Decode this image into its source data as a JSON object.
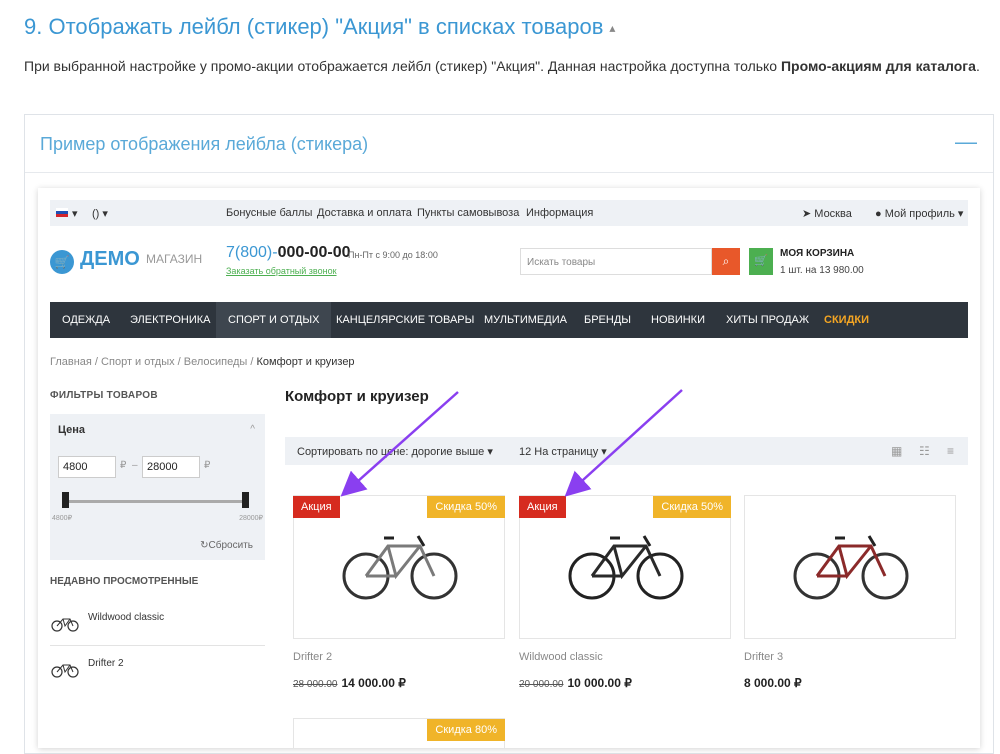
{
  "doc": {
    "title": "9. Отображать лейбл (стикер) \"Акция\" в списках товаров",
    "desc_plain": "При выбранной настройке у промо-акции отображается лейбл (стикер) \"Акция\". Данная настройка доступна только ",
    "desc_bold": "Промо-акциям для каталога",
    "desc_end": ".",
    "spoiler_title": "Пример отображения лейбла (стикера)",
    "collapse_symbol": "—"
  },
  "shop": {
    "topbar": {
      "lang": "▾",
      "currency": "() ▾",
      "links": [
        "Бонусные баллы",
        "Доставка и оплата",
        "Пункты самовывоза",
        "Информация"
      ],
      "city": "Москва",
      "profile": "Мой профиль"
    },
    "logo_main": "ДЕМО",
    "logo_sub": "МАГАЗИН",
    "phone_prefix": "7(800)-",
    "phone_main": "000-00-00",
    "hours": "Пн-Пт с 9:00 до 18:00",
    "callback": "Заказать обратный звонок",
    "search_placeholder": "Искать товары",
    "cart_title": "МОЯ КОРЗИНА",
    "cart_sub": "1 шт. на 13 980.00",
    "menu": [
      "ОДЕЖДА",
      "ЭЛЕКТРОНИКА",
      "СПОРТ И ОТДЫХ",
      "КАНЦЕЛЯРСКИЕ ТОВАРЫ",
      "МУЛЬТИМЕДИА",
      "БРЕНДЫ",
      "НОВИНКИ",
      "ХИТЫ ПРОДАЖ",
      "СКИДКИ"
    ],
    "breadcrumbs": [
      "Главная",
      "Спорт и отдых",
      "Велосипеды"
    ],
    "breadcrumb_current": "Комфорт и круизер",
    "filters_title": "ФИЛЬТРЫ ТОВАРОВ",
    "price_title": "Цена",
    "price_min": "4800",
    "price_max": "28000",
    "currency_sign": "₽",
    "range_dash": "–",
    "slider_min_label": "4800₽",
    "slider_max_label": "28000₽",
    "reset": "Сбросить",
    "recent_title": "НЕДАВНО ПРОСМОТРЕННЫЕ",
    "recent": [
      "Wildwood classic",
      "Drifter 2"
    ],
    "category_title": "Комфорт и круизер",
    "sort_label": "Сортировать по цене: дорогие выше ▾",
    "per_page": "12 На страницу ▾",
    "products": [
      {
        "name": "Drifter 2",
        "old_price": "28 000.00",
        "price": "14 000.00 ₽",
        "sale": "Акция",
        "discount": "Скидка 50%",
        "frame_color": "#7a7a7a"
      },
      {
        "name": "Wildwood classic",
        "old_price": "20 000.00",
        "price": "10 000.00 ₽",
        "sale": "Акция",
        "discount": "Скидка 50%",
        "frame_color": "#2a2a2a"
      },
      {
        "name": "Drifter 3",
        "old_price": "",
        "price": "8 000.00 ₽",
        "sale": "",
        "discount": "",
        "frame_color": "#8b2a2a"
      }
    ],
    "card4_discount": "Скидка 80%"
  },
  "colors": {
    "accent": "#3b97d3",
    "sale_tag": "#d62b1f",
    "discount_tag": "#f0b429",
    "arrow": "#8a3ff0",
    "menu_bg": "#2e353d"
  }
}
